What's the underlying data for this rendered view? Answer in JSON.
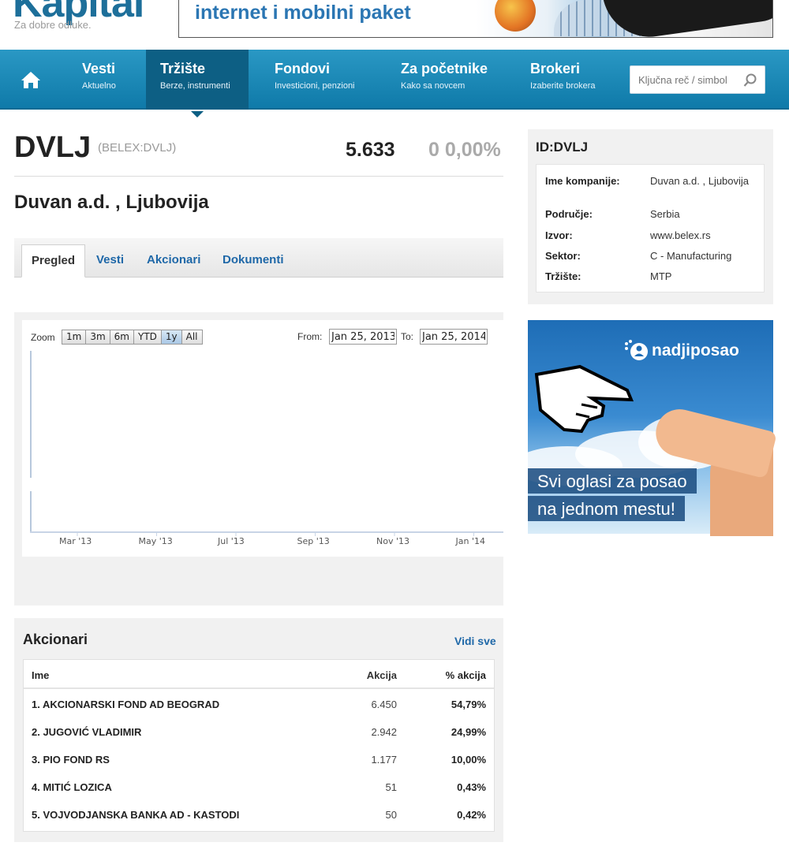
{
  "site": {
    "logo": "Kapital",
    "tagline": "Za dobre odluke.",
    "top_banner_text": "internet i mobilni paket"
  },
  "nav": {
    "items": [
      {
        "title": "Vesti",
        "subtitle": "Aktuelno"
      },
      {
        "title": "Tržište",
        "subtitle": "Berze, instrumenti"
      },
      {
        "title": "Fondovi",
        "subtitle": "Investicioni, penzioni"
      },
      {
        "title": "Za početnike",
        "subtitle": "Kako sa novcem"
      },
      {
        "title": "Brokeri",
        "subtitle": "Izaberite brokera"
      }
    ],
    "active_index": 1,
    "search_placeholder": "Ključna reč / simbol"
  },
  "stock": {
    "ticker": "DVLJ",
    "exchange_code": "(BELEX:DVLJ)",
    "price": "5.633",
    "change": "0 0,00%",
    "company": "Duvan a.d. , Ljubovija"
  },
  "tabs": [
    "Pregled",
    "Vesti",
    "Akcionari",
    "Dokumenti"
  ],
  "chart": {
    "zoom_label": "Zoom",
    "zoom_buttons": [
      "1m",
      "3m",
      "6m",
      "YTD",
      "1y",
      "All"
    ],
    "zoom_selected": "1y",
    "from_label": "From:",
    "from_value": "Jan 25, 2013",
    "to_label": "To:",
    "to_value": "Jan 25, 2014"
  },
  "chart_data": {
    "type": "line",
    "x_ticks": [
      "Mar '13",
      "May '13",
      "Jul '13",
      "Sep '13",
      "Nov '13",
      "Jan '14"
    ],
    "series": [],
    "grid": false
  },
  "shareholders": {
    "title": "Akcionari",
    "see_all": "Vidi sve",
    "headers": {
      "name": "Ime",
      "shares": "Akcija",
      "percent": "% akcija"
    },
    "rows": [
      {
        "name": "1. AKCIONARSKI FOND AD BEOGRAD",
        "shares": "6.450",
        "percent": "54,79%"
      },
      {
        "name": "2. JUGOVIĆ VLADIMIR",
        "shares": "2.942",
        "percent": "24,99%"
      },
      {
        "name": "3. PIO FOND RS",
        "shares": "1.177",
        "percent": "10,00%"
      },
      {
        "name": "4. MITIĆ LOZICA",
        "shares": "51",
        "percent": "0,43%"
      },
      {
        "name": "5. VOJVODJANSKA BANKA AD - KASTODI",
        "shares": "50",
        "percent": "0,42%"
      }
    ]
  },
  "id_box": {
    "title": "ID:DVLJ",
    "fields": [
      {
        "key": "Ime kompanije:",
        "value": "Duvan a.d. , Ljubovija"
      },
      {
        "key": "Područje:",
        "value": "Serbia"
      },
      {
        "key": "Izvor:",
        "value": "www.belex.rs"
      },
      {
        "key": "Sektor:",
        "value": "C - Manufacturing"
      },
      {
        "key": "Tržište:",
        "value": "MTP"
      }
    ]
  },
  "ad": {
    "brand": "nadjiposao",
    "line1": "Svi oglasi za posao",
    "line2": "na jednom mestu!"
  },
  "colors": {
    "nav_bg": "#1a8bb9",
    "nav_active": "#0d5f84",
    "link": "#1f68a8",
    "muted": "#9a9a9a"
  }
}
